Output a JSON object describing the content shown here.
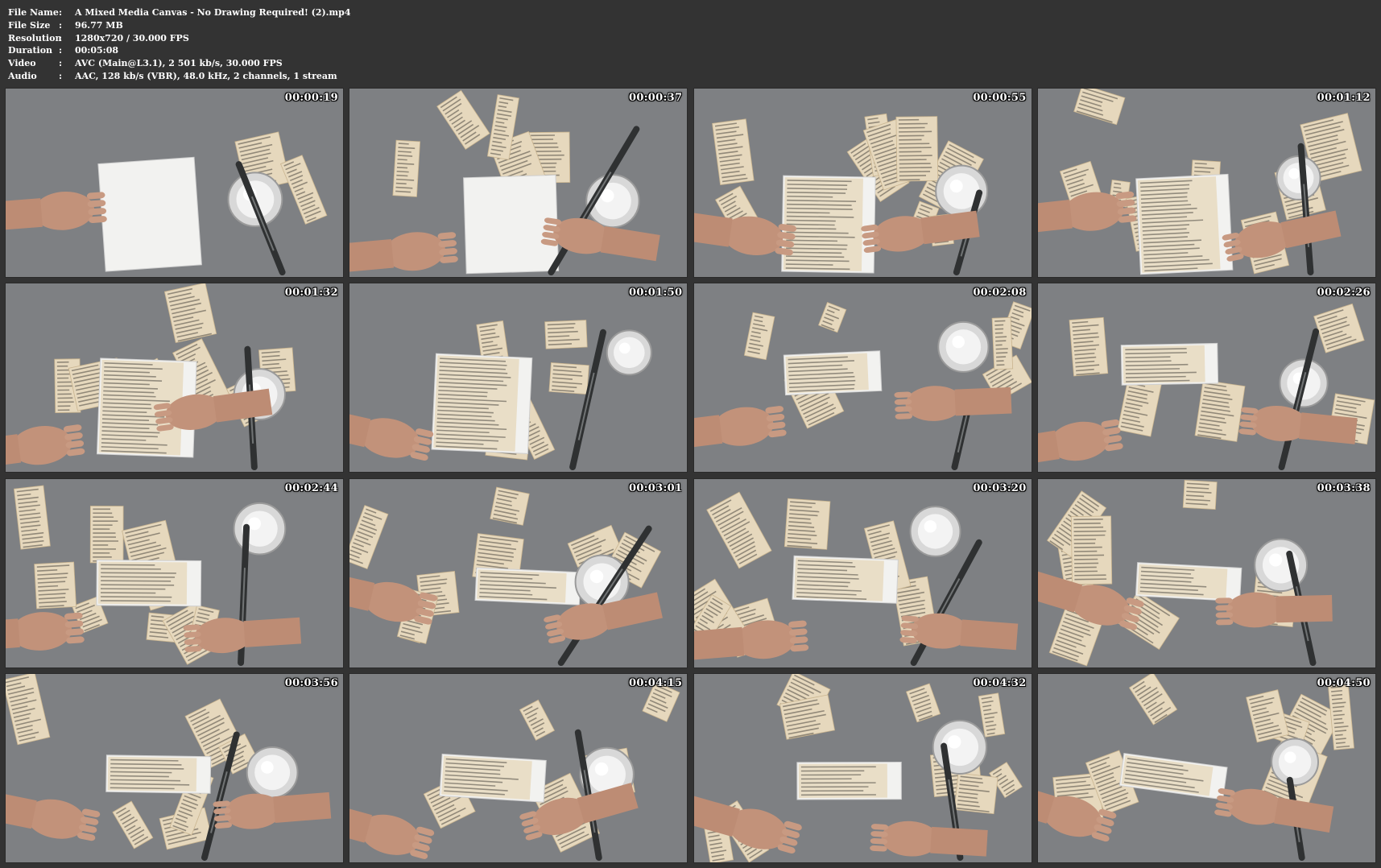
{
  "info": [
    {
      "label": "File Name",
      "value": "A Mixed Media Canvas - No Drawing Required! (2).mp4"
    },
    {
      "label": "File Size",
      "value": "96.77 MB"
    },
    {
      "label": "Resolution",
      "value": "1280x720 / 30.000 FPS"
    },
    {
      "label": "Duration",
      "value": "00:05:08"
    },
    {
      "label": "Video",
      "value": "AVC (Main@L3.1), 2 501 kb/s, 30.000 FPS"
    },
    {
      "label": "Audio",
      "value": "AAC, 128 kb/s (VBR), 48.0 kHz, 2 channels, 1 stream"
    }
  ],
  "separator": ":",
  "thumbnails": [
    {
      "time": "00:00:19"
    },
    {
      "time": "00:00:37"
    },
    {
      "time": "00:00:55"
    },
    {
      "time": "00:01:12"
    },
    {
      "time": "00:01:32"
    },
    {
      "time": "00:01:50"
    },
    {
      "time": "00:02:08"
    },
    {
      "time": "00:02:26"
    },
    {
      "time": "00:02:44"
    },
    {
      "time": "00:03:01"
    },
    {
      "time": "00:03:20"
    },
    {
      "time": "00:03:38"
    },
    {
      "time": "00:03:56"
    },
    {
      "time": "00:04:15"
    },
    {
      "time": "00:04:32"
    },
    {
      "time": "00:04:50"
    }
  ],
  "colors": {
    "background": "#333333",
    "table": "#7d7f82",
    "paper": "#e8dcc4",
    "canvas": "#f4f4f2",
    "skin": "#c4957e"
  }
}
